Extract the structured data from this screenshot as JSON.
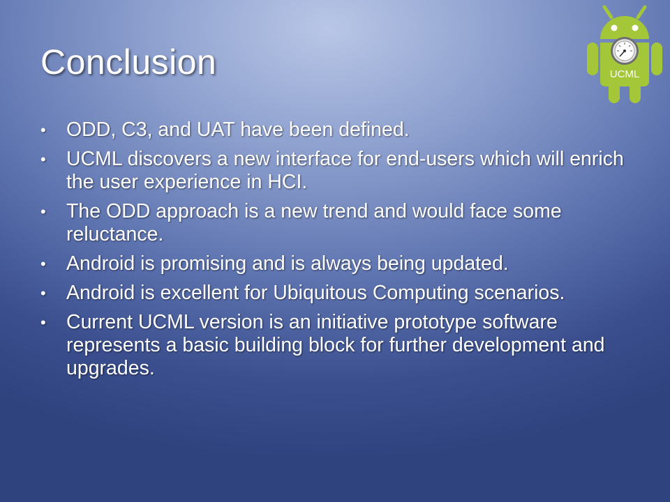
{
  "slide": {
    "title": "Conclusion",
    "bullets": [
      "ODD, C3, and UAT have been defined.",
      "UCML discovers a new interface for end-users which will enrich the user experience in HCI.",
      "The ODD approach is a new trend and would face some reluctance.",
      "Android is promising and is always being updated.",
      "Android is excellent for Ubiquitous Computing scenarios.",
      "Current UCML version is an initiative prototype software represents a basic building block for further development and upgrades."
    ]
  },
  "logo": {
    "icon": "android-gauge-logo-icon",
    "label": "UCML"
  },
  "colors": {
    "android_green": "#a4c639",
    "text": "#ffffff",
    "background_dark": "#2f437f",
    "background_light": "#b9c6e6"
  }
}
